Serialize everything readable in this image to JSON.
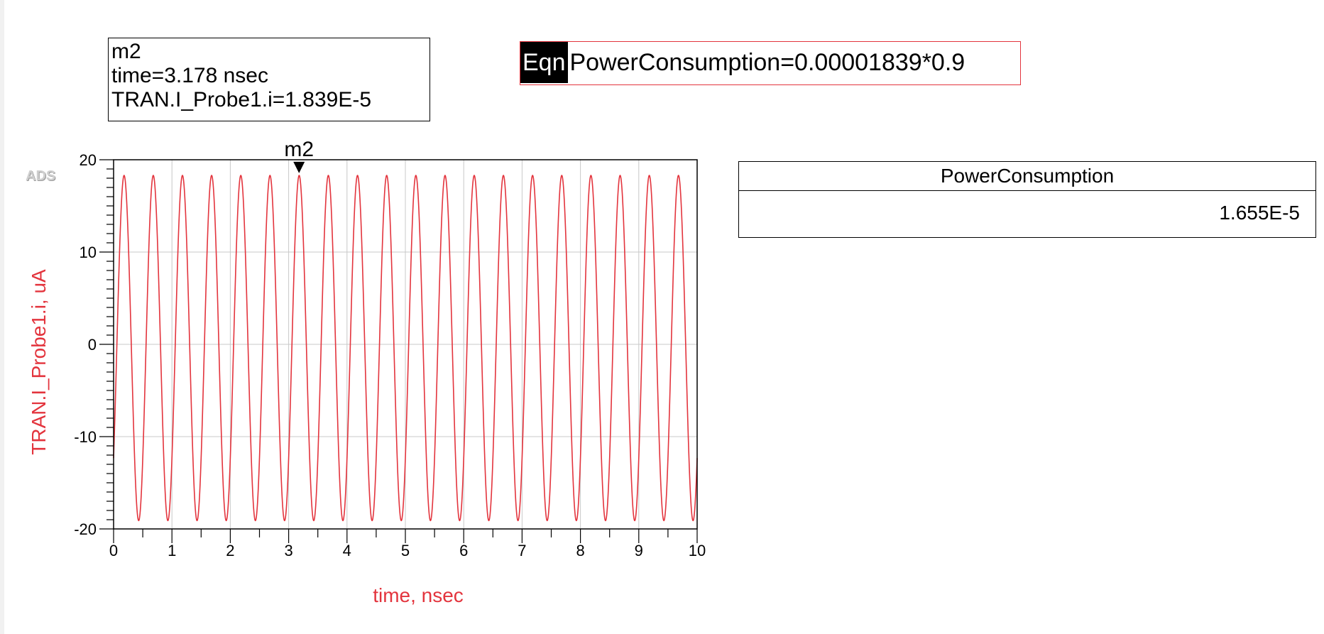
{
  "marker_readout": {
    "name": "m2",
    "time_line": "time=3.178 nsec",
    "value_line": "TRAN.I_Probe1.i=1.839E-5"
  },
  "equation": {
    "tag": "Eqn",
    "text": "PowerConsumption=0.00001839*0.9"
  },
  "logo": "ADS",
  "results_table": {
    "header": "PowerConsumption",
    "value": "1.655E-5"
  },
  "colors": {
    "trace": "#e3343d",
    "grid": "#c8c8c8",
    "axis": "#000000"
  },
  "chart_data": {
    "type": "line",
    "xlabel": "time, nsec",
    "ylabel": "TRAN.I_Probe1.i, uA",
    "xlim": [
      0,
      10
    ],
    "ylim": [
      -20,
      20
    ],
    "x_ticks": [
      0,
      1,
      2,
      3,
      4,
      5,
      6,
      7,
      8,
      9,
      10
    ],
    "y_ticks": [
      20,
      10,
      0,
      -10,
      -20
    ],
    "x_tick_labels": [
      "0",
      "1",
      "2",
      "3",
      "4",
      "5",
      "6",
      "7",
      "8",
      "9",
      "10"
    ],
    "y_tick_labels": [
      "20",
      "10",
      "0",
      "-10",
      "-20"
    ],
    "grid": true,
    "series": [
      {
        "waveform": "sine",
        "period_ns": 0.5,
        "amplitude_uA": 18.7,
        "offset_uA": -0.4,
        "phase_ns": 0.055,
        "x_start": 0,
        "x_end": 10
      }
    ],
    "markers": [
      {
        "name": "m2",
        "x": 3.178,
        "y": 18.39
      }
    ]
  }
}
